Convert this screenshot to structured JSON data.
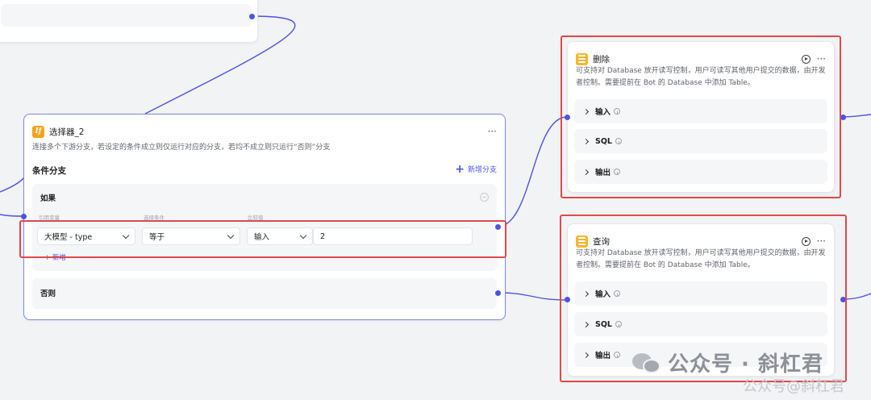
{
  "selector_node": {
    "badge": "If",
    "title": "选择器_2",
    "description": "连接多个下游分支，若设定的条件成立则仅运行对应的分支，若均不成立则只运行“否则”分支",
    "section_title": "条件分支",
    "add_branch_label": "新增分支",
    "if_label": "如果",
    "captions": {
      "ref": "引用变量",
      "op": "选择条件",
      "cmp": "比较值"
    },
    "ref_value": "大模型 - type",
    "op_value": "等于",
    "cmp_type": "输入",
    "cmp_value": "2",
    "add_condition_label": "+ 新增",
    "else_label": "否则"
  },
  "delete_node": {
    "title": "删除",
    "description": "可支持对 Database 放开读写控制，用户可读写其他用户提交的数据，由开发者控制。需要提前在 Bot 的 Database 中添加 Table。",
    "rows": [
      {
        "label": "输入"
      },
      {
        "label": "SQL"
      },
      {
        "label": "输出"
      }
    ]
  },
  "query_node": {
    "title": "查询",
    "description": "可支持对 Database 放开读写控制，用户可读写其他用户提交的数据，由开发者控制。需要提前在 Bot 的 Database 中添加 Table。",
    "rows": [
      {
        "label": "输入"
      },
      {
        "label": "SQL"
      },
      {
        "label": "输出"
      }
    ]
  },
  "watermark": {
    "main": "公众号 · 斜杠君",
    "sub": "公众号@斜杠君"
  },
  "colors": {
    "accent": "#4d53e8",
    "highlight": "#e34848",
    "node_badge": "#f7a21b"
  }
}
